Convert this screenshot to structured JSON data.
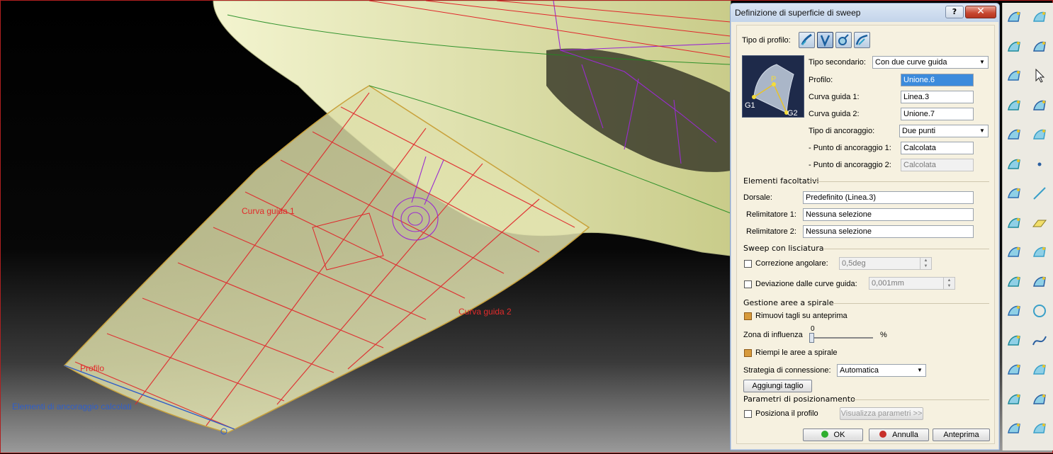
{
  "viewport": {
    "labels": {
      "curva_guida_1": "Curva guida 1",
      "curva_guida_2": "Curva guida 2",
      "profilo": "Profilo",
      "elementi_ancoraggio": "Elementi di ancoraggio calcolati"
    },
    "colors": {
      "surface": "#e6e8b4",
      "wireframe_red": "#e0262a",
      "wireframe_purple": "#9a2bd1",
      "wireframe_green": "#1e8a1e",
      "label_red": "#e22b2b",
      "label_blue": "#2f5ec8"
    }
  },
  "dialog": {
    "title": "Definizione di superficie di sweep",
    "help": "?",
    "close": "✕",
    "tipo_profilo_label": "Tipo di profilo:",
    "tipo_secondario_label": "Tipo secondario:",
    "tipo_secondario_value": "Con due curve guida",
    "diagram": {
      "g1": "G1",
      "g2": "G2",
      "p": "P"
    },
    "profilo_label": "Profilo:",
    "profilo_value": "Unione.6",
    "curva1_label": "Curva guida 1:",
    "curva1_value": "Linea.3",
    "curva2_label": "Curva guida 2:",
    "curva2_value": "Unione.7",
    "ancoraggio_label": "Tipo di ancoraggio:",
    "ancoraggio_value": "Due punti",
    "punto1_label": "- Punto di ancoraggio 1:",
    "punto1_value": "Calcolata",
    "punto2_label": "- Punto di ancoraggio 2:",
    "punto2_value": "Calcolata",
    "facoltativi_title": "Elementi facoltativi",
    "dorsale_label": "Dorsale:",
    "dorsale_value": "Predefinito (Linea.3)",
    "relim1_label": "Relimitatore 1:",
    "relim1_value": "Nessuna selezione",
    "relim2_label": "Relimitatore 2:",
    "relim2_value": "Nessuna selezione",
    "lisciatura_title": "Sweep con lisciatura",
    "correzione_label": "Correzione angolare:",
    "correzione_value": "0,5deg",
    "deviazione_label": "Deviazione dalle curve guida:",
    "deviazione_value": "0,001mm",
    "spirale_title": "Gestione aree a spirale",
    "rimuovi_label": "Rimuovi tagli su anteprima",
    "zona_label": "Zona di influenza",
    "zona_value": "0",
    "zona_fraction": 0.0,
    "zona_unit": "%",
    "riempi_label": "Riempi le aree a spirale",
    "strategia_label": "Strategia di connessione:",
    "strategia_value": "Automatica",
    "aggiungi_label": "Aggiungi taglio",
    "posizionamento_title": "Parametri di posizionamento",
    "posiziona_label": "Posiziona il profilo",
    "visualizza_label": "Visualizza parametri >>",
    "ok_label": "OK",
    "annulla_label": "Annulla",
    "anteprima_label": "Anteprima",
    "checkbox_state": {
      "correzione": false,
      "deviazione": false,
      "rimuovi": true,
      "riempi": true,
      "posiziona": false
    }
  },
  "toolbar": {
    "icons": [
      "sweep-icon",
      "swap-icon",
      "extrude-icon",
      "measure-icon",
      "revolve-icon",
      "select-arrow-icon",
      "offset-icon",
      "snap-icon",
      "blend-icon",
      "sketch-icon",
      "fill-icon",
      "point-icon",
      "multi-section-icon",
      "line-icon",
      "join-icon",
      "plane-icon",
      "healing-icon",
      "projection-icon",
      "split-icon",
      "intersect-icon",
      "trim-icon",
      "circle-icon",
      "boundary-icon",
      "spline-icon",
      "extract-icon",
      "corner-icon",
      "translate-icon",
      "rotate-icon",
      "symmetry-icon",
      "scale-icon"
    ]
  }
}
